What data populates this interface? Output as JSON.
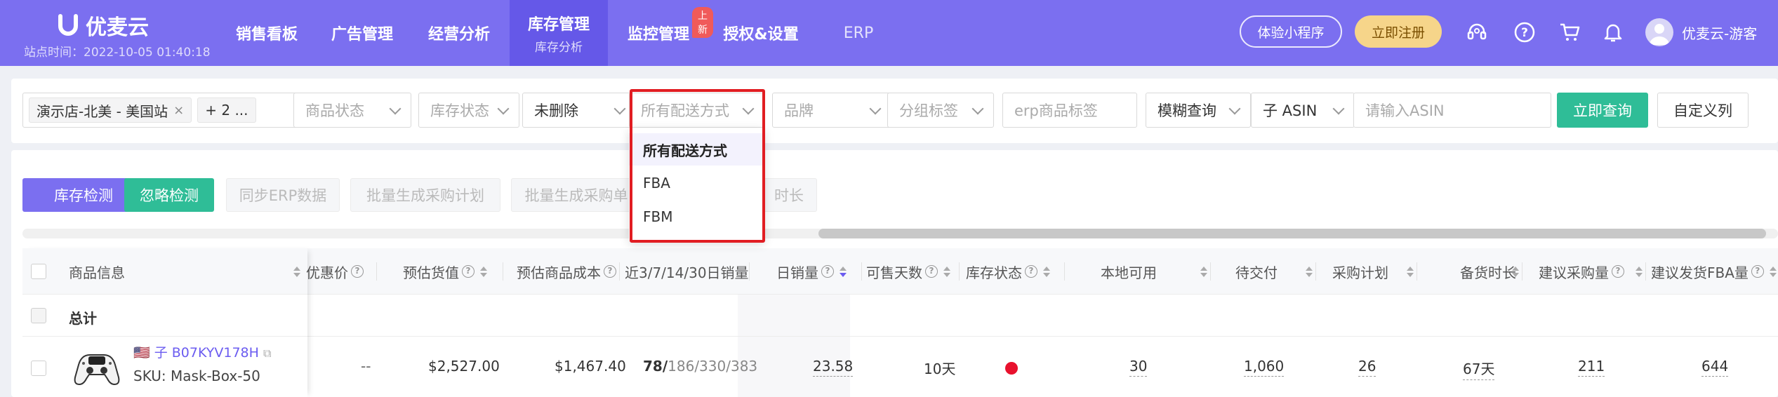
{
  "nav": {
    "logo_text": "优麦云",
    "site_time": "站点时间：2022-10-05 01:40:18",
    "items": [
      {
        "label": "销售看板"
      },
      {
        "label": "广告管理"
      },
      {
        "label": "经营分析"
      },
      {
        "label": "库存管理",
        "sub": "库存分析"
      },
      {
        "label": "监控管理",
        "badge": "上新"
      },
      {
        "label": "授权&设置"
      },
      {
        "label": "ERP"
      }
    ],
    "mini_program_label": "体验小程序",
    "register_label": "立即注册",
    "icons": [
      "headset-icon",
      "help-icon",
      "cart-icon",
      "bell-icon"
    ],
    "user_name": "优麦云-游客"
  },
  "filters": {
    "shop_tag": "演示店-北美 - 美国站",
    "shop_more": "+ 2 ...",
    "product_status": "商品状态",
    "stock_status": "库存状态",
    "deleted": "未删除",
    "shipping": "所有配送方式",
    "brand": "品牌",
    "group_tag": "分组标签",
    "erp_tag": "erp商品标签",
    "fuzzy": "模糊查询",
    "asin_type": "子 ASIN",
    "asin_placeholder": "请输入ASIN",
    "query_label": "立即查询",
    "custom_cols_label": "自定义列"
  },
  "dropdown": {
    "options": [
      "所有配送方式",
      "FBA",
      "FBM"
    ],
    "selected": "所有配送方式"
  },
  "actions": {
    "stock_check": "库存检测",
    "ignore_check": "忽略检测",
    "sync_erp": "同步ERP数据",
    "batch_plan": "批量生成采购计划",
    "batch_order": "批量生成采购单",
    "stock_hidden_tail": "时长"
  },
  "table": {
    "headers": {
      "product_info": "商品信息",
      "discount": "优惠价",
      "est_value": "预估货值",
      "est_cost": "预估商品成本",
      "sales_3_7_14_30": "近3/7/14/30日销量",
      "daily_sales": "日销量",
      "sellable_days": "可售天数",
      "stock_status": "库存状态",
      "local_available": "本地可用",
      "pending_delivery": "待交付",
      "purchase_plan": "采购计划",
      "stock_duration": "备货时长",
      "suggest_purchase": "建议采购量",
      "suggest_fba": "建议发货FBA量"
    },
    "total_label": "总计",
    "row": {
      "flag": "🇺🇸",
      "asin": "子 B07KYV178H",
      "sku": "SKU: Mask-Box-50",
      "discount": "--",
      "est_value": "$2,527.00",
      "est_cost": "$1,467.40",
      "sales_bold": "78/",
      "sales_rest": "186/330/383",
      "daily_sales": "23.58",
      "sellable_days": "10天",
      "status_color": "#e8112d",
      "local_available": "30",
      "pending_delivery": "1,060",
      "purchase_plan": "26",
      "stock_duration": "67天",
      "suggest_purchase": "211",
      "suggest_fba": "644"
    }
  }
}
